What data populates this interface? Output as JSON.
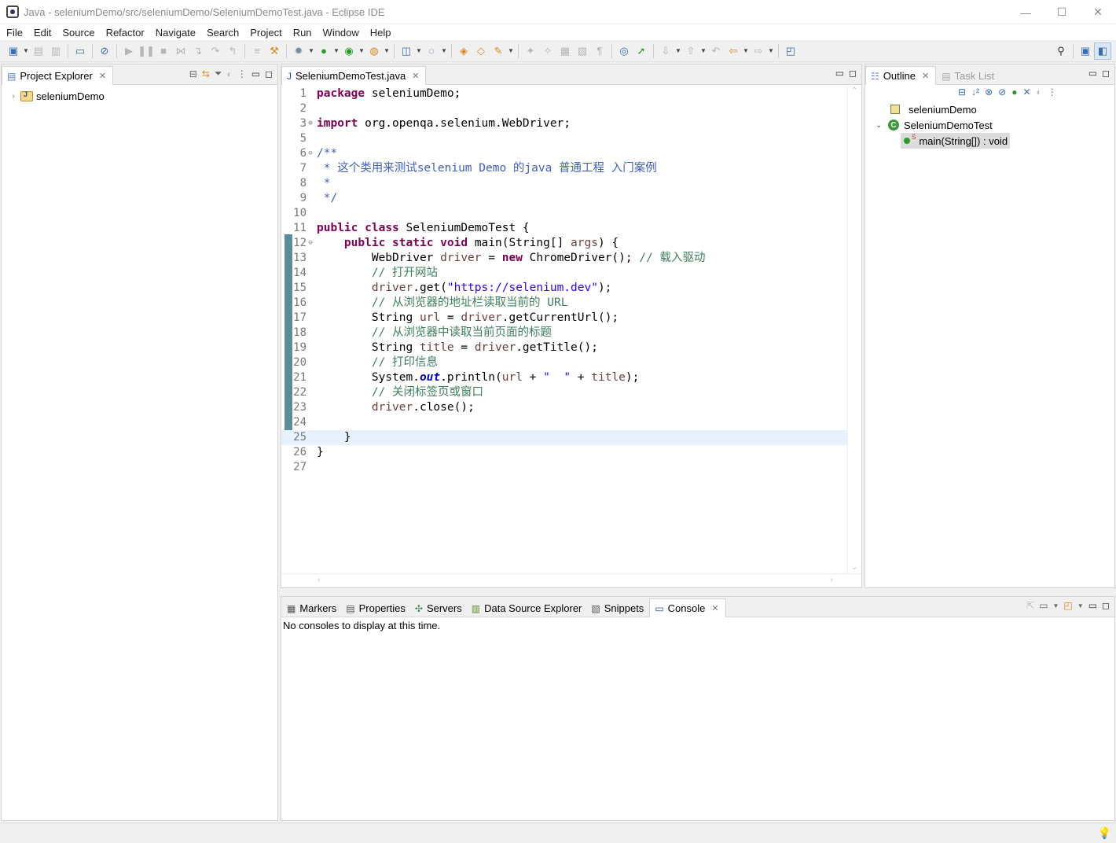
{
  "window": {
    "title": "Java - seleniumDemo/src/seleniumDemo/SeleniumDemoTest.java - Eclipse IDE",
    "minimize": "—",
    "maximize": "☐",
    "close": "✕"
  },
  "menu": [
    "File",
    "Edit",
    "Source",
    "Refactor",
    "Navigate",
    "Search",
    "Project",
    "Run",
    "Window",
    "Help"
  ],
  "project_explorer": {
    "tab_label": "Project Explorer",
    "items": [
      {
        "label": "seleniumDemo",
        "expanded": false
      }
    ]
  },
  "editor": {
    "tab_label": "SeleniumDemoTest.java",
    "current_line": 25,
    "lines": [
      {
        "n": "1",
        "text": "package seleniumDemo;"
      },
      {
        "n": "2",
        "text": ""
      },
      {
        "n": "3",
        "text": "import org.openqa.selenium.WebDriver;",
        "fold": "⊕"
      },
      {
        "n": "5",
        "text": ""
      },
      {
        "n": "6",
        "text": "/**",
        "fold": "⊖"
      },
      {
        "n": "7",
        "text": " * 这个类用来测试selenium Demo 的java 普通工程 入门案例"
      },
      {
        "n": "8",
        "text": " *"
      },
      {
        "n": "9",
        "text": " */"
      },
      {
        "n": "10",
        "text": ""
      },
      {
        "n": "11",
        "text": "public class SeleniumDemoTest {"
      },
      {
        "n": "12",
        "text": "    public static void main(String[] args) {",
        "fold": "⊖"
      },
      {
        "n": "13",
        "text": "        WebDriver driver = new ChromeDriver(); // 载入驱动"
      },
      {
        "n": "14",
        "text": "        // 打开网站"
      },
      {
        "n": "15",
        "text": "        driver.get(\"https://selenium.dev\");"
      },
      {
        "n": "16",
        "text": "        // 从浏览器的地址栏读取当前的 URL"
      },
      {
        "n": "17",
        "text": "        String url = driver.getCurrentUrl();"
      },
      {
        "n": "18",
        "text": "        // 从浏览器中读取当前页面的标题"
      },
      {
        "n": "19",
        "text": "        String title = driver.getTitle();"
      },
      {
        "n": "20",
        "text": "        // 打印信息"
      },
      {
        "n": "21",
        "text": "        System.out.println(url + \"  \" + title);"
      },
      {
        "n": "22",
        "text": "        // 关闭标签页或窗口"
      },
      {
        "n": "23",
        "text": "        driver.close();"
      },
      {
        "n": "24",
        "text": ""
      },
      {
        "n": "25",
        "text": "    }"
      },
      {
        "n": "26",
        "text": "}"
      },
      {
        "n": "27",
        "text": ""
      }
    ]
  },
  "outline": {
    "tab_label": "Outline",
    "second_tab_label": "Task List",
    "items": [
      {
        "label": "seleniumDemo",
        "kind": "package"
      },
      {
        "label": "SeleniumDemoTest",
        "kind": "class",
        "expanded": true
      },
      {
        "label": "main(String[]) : void",
        "kind": "method",
        "modifier": "S",
        "selected": true
      }
    ]
  },
  "bottom_panel": {
    "tabs": [
      {
        "label": "Markers",
        "icon": "markers-icon",
        "active": false
      },
      {
        "label": "Properties",
        "icon": "properties-icon",
        "active": false
      },
      {
        "label": "Servers",
        "icon": "servers-icon",
        "active": false
      },
      {
        "label": "Data Source Explorer",
        "icon": "data-source-icon",
        "active": false
      },
      {
        "label": "Snippets",
        "icon": "snippets-icon",
        "active": false
      },
      {
        "label": "Console",
        "icon": "console-icon",
        "active": true
      }
    ],
    "console_message": "No consoles to display at this time."
  },
  "colors": {
    "keyword": "#7f0055",
    "comment": "#3f7f5f",
    "javadoc": "#3f5fbf",
    "string": "#2a00ff",
    "local_variable": "#6a3e3e",
    "static_field": "#0000c0",
    "current_line": "#e8f2fe",
    "change_bar": "#5a8c9c"
  }
}
